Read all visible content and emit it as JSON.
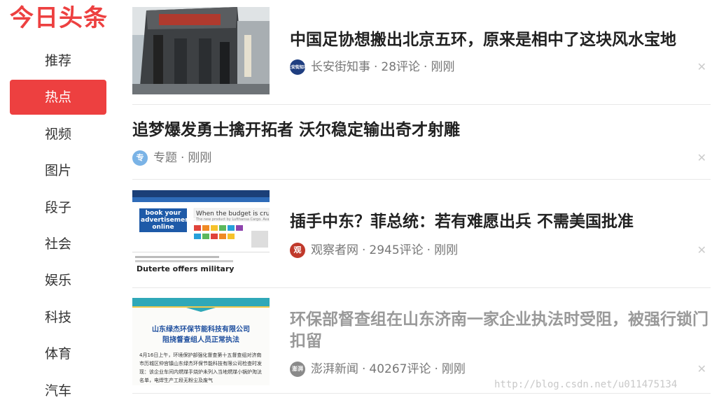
{
  "brand": {
    "logo": "今日头条",
    "color": "#ed4040"
  },
  "nav": {
    "items": [
      {
        "label": "推荐"
      },
      {
        "label": "热点",
        "active": true
      },
      {
        "label": "视频"
      },
      {
        "label": "图片"
      },
      {
        "label": "段子"
      },
      {
        "label": "社会"
      },
      {
        "label": "娱乐"
      },
      {
        "label": "科技"
      },
      {
        "label": "体育"
      },
      {
        "label": "汽车"
      }
    ]
  },
  "feed": [
    {
      "title": "中国足协想搬出北京五环，原来是相中了这块风水宝地",
      "source": "长安街知事",
      "comments": "28评论",
      "time": "刚刚",
      "icon_text": "长安街知事"
    },
    {
      "title": "追梦爆发勇士擒开拓者 沃尔稳定输出奇才射雕",
      "source": "专题",
      "time": "刚刚",
      "icon_text": "专"
    },
    {
      "title": "插手中东？菲总统：若有难愿出兵 不需美国批准",
      "source": "观察者网",
      "comments": "2945评论",
      "time": "刚刚",
      "icon_text": "观",
      "thumb": {
        "ad_line1": "book your",
        "ad_line2": "advertisements",
        "ad_line3": "online",
        "banner": "When the budget is cru",
        "banner_sub": "The new product by Lufthansa Cargo. Availa",
        "headline": "Duterte offers military"
      }
    },
    {
      "title": "环保部督查组在山东济南一家企业执法时受阻，被强行锁门扣留",
      "source": "澎湃新闻",
      "comments": "40267评论",
      "time": "刚刚",
      "icon_text": "澎湃",
      "thumb": {
        "heading1": "山东绿杰环保节能科技有限公司",
        "heading2": "阻挠督查组人员正常执法",
        "body": "4月16日上午，环境保护部强化督查第十五督查组对济南市历城区仲宫镇山东绿杰环保节能科技有限公司检查时发现：该企业车间内燃煤手烧炉未列入当地燃煤小锅炉淘汰名单，电焊生产工段无粉尘及废气"
      }
    }
  ],
  "close_glyph": "✕",
  "dot": "·",
  "watermark": "http://blog.csdn.net/u011475134"
}
